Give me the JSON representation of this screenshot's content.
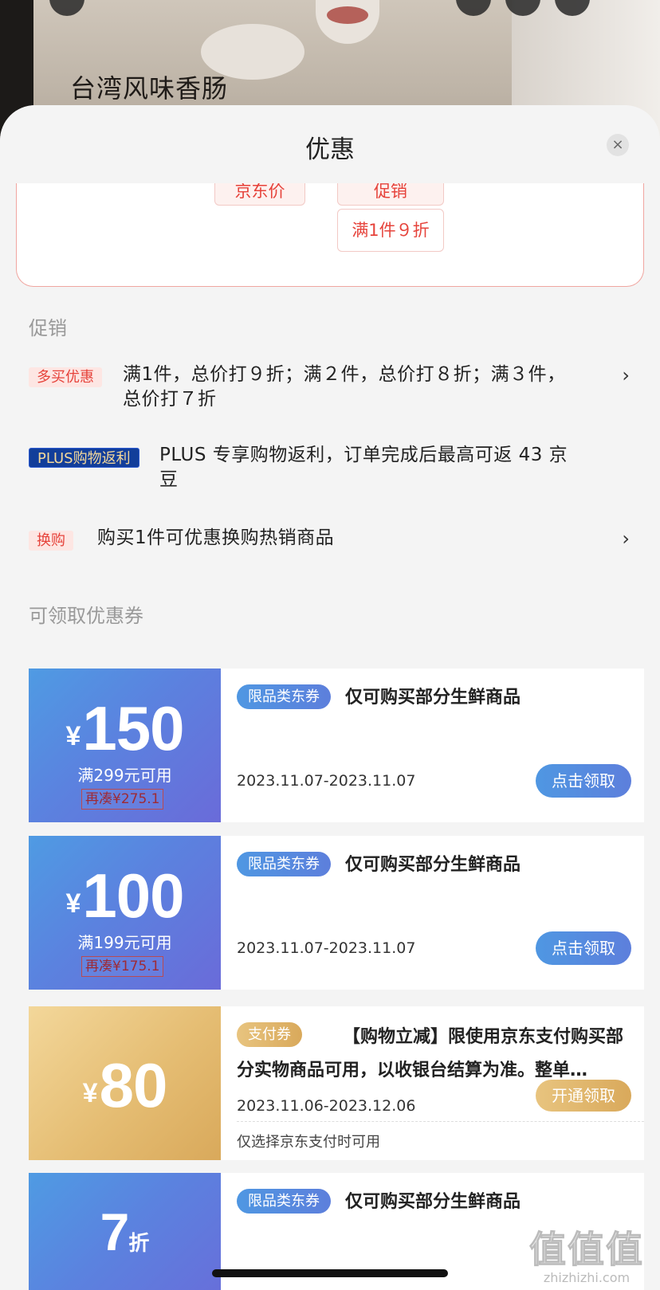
{
  "product": {
    "title": "台湾风味香肠"
  },
  "sheet": {
    "title": "优惠",
    "close_icon": "×"
  },
  "price_tags": {
    "jd_price": "京东价",
    "promo_label": "促销",
    "promo_value": "满1件９折"
  },
  "promotions": {
    "section_label": "促销",
    "items": [
      {
        "badge": "多买优惠",
        "text_line1": "满1件，总价打９折；满２件，总价打８折；满３件，",
        "text_line2": "总价打７折",
        "chevron": "›"
      },
      {
        "badge": "PLUS购物返利",
        "text_line1": "PLUS 专享购物返利，订单完成后最高可返 43 京",
        "text_line2": "豆"
      },
      {
        "badge": "换购",
        "text_line1": "购买1件可优惠换购热销商品",
        "chevron": "›"
      }
    ]
  },
  "coupons": {
    "section_label": "可领取优惠券",
    "items": [
      {
        "yen": "¥",
        "amount": "150",
        "condition": "满299元可用",
        "gap": "再凑¥275.1",
        "category": "限品类东券",
        "desc": "仅可购买部分生鲜商品",
        "date": "2023.11.07-2023.11.07",
        "button": "点击领取"
      },
      {
        "yen": "¥",
        "amount": "100",
        "condition": "满199元可用",
        "gap": "再凑¥175.1",
        "category": "限品类东券",
        "desc": "仅可购买部分生鲜商品",
        "date": "2023.11.07-2023.11.07",
        "button": "点击领取"
      },
      {
        "yen": "¥",
        "amount": "80",
        "category": "支付券",
        "desc": "【购物立减】限使用京东支付购买部分实物商品可用，以收银台结算为准。整单…",
        "date": "2023.11.06-2023.12.06",
        "button": "开通领取",
        "note": "仅选择京东支付时可用"
      },
      {
        "amount": "7",
        "unit": "折",
        "category": "限品类东券",
        "desc": "仅可购买部分生鲜商品"
      }
    ]
  },
  "watermark": {
    "logo": "值值值",
    "url": "zhizhizhi.com"
  },
  "colors": {
    "accent_red": "#e6433b",
    "coupon_blue": "#5b82df",
    "coupon_gold": "#e5bd73"
  }
}
